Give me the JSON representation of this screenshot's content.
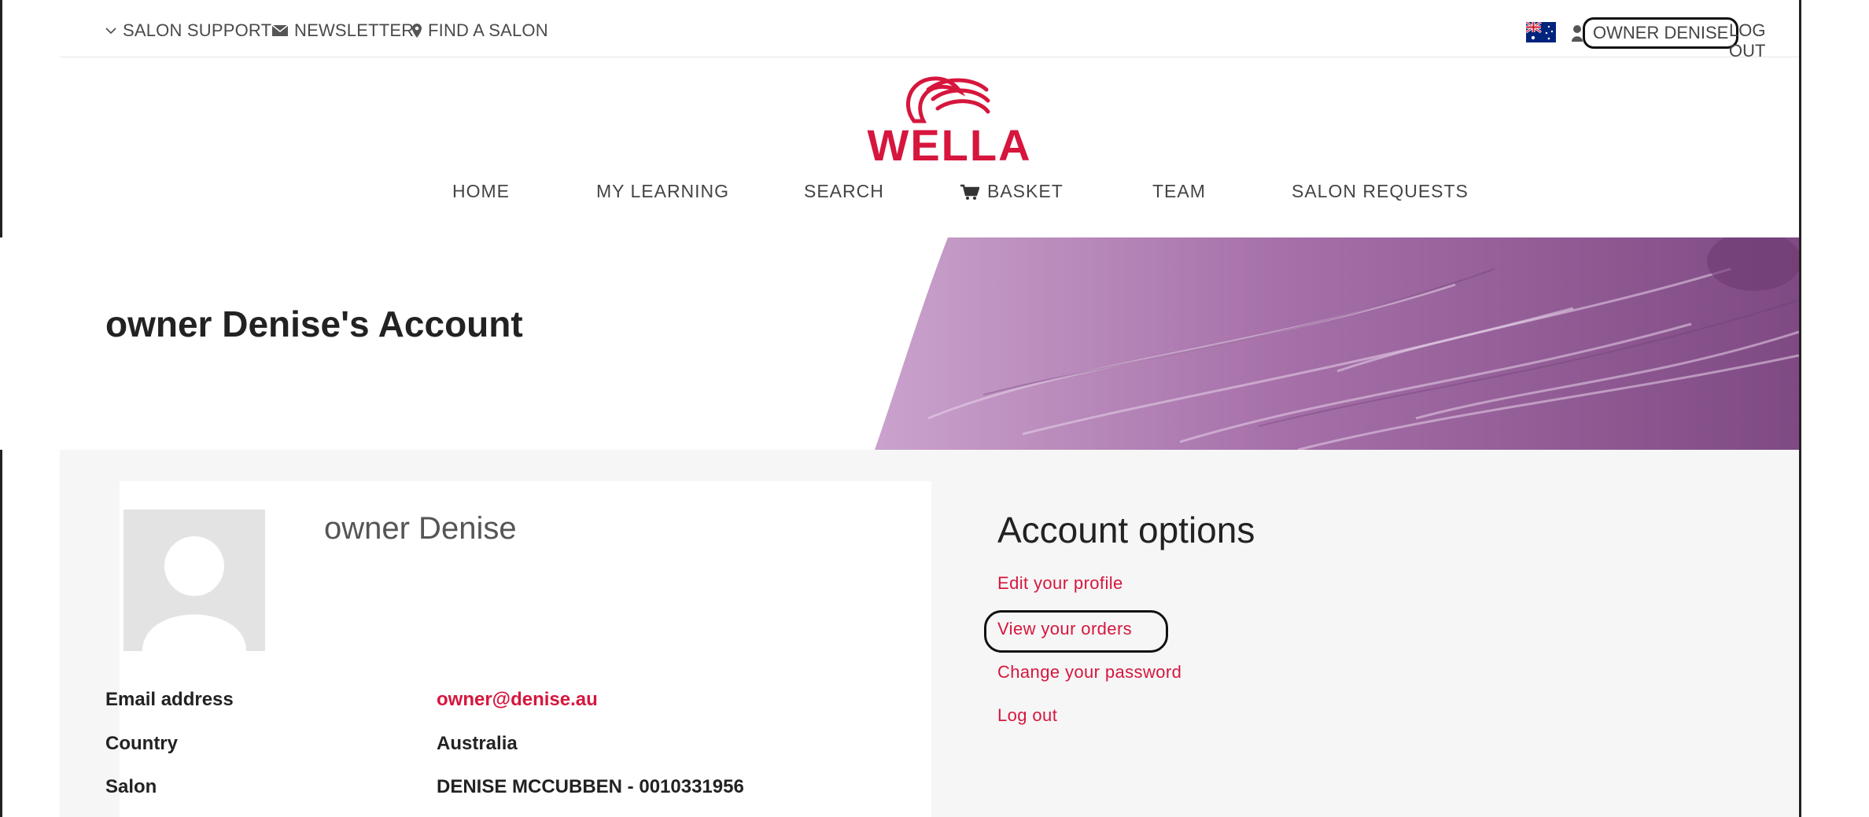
{
  "topbar": {
    "salon_support": "SALON SUPPORT",
    "newsletter": "NEWSLETTER",
    "find_salon": "FIND A SALON",
    "user_name": "OWNER DENISE",
    "logout": "LOG OUT"
  },
  "brand": {
    "logo_text": "WELLA",
    "color": "#d6163d"
  },
  "nav": {
    "home": "HOME",
    "my_learning": "MY LEARNING",
    "search": "SEARCH",
    "basket": "BASKET",
    "team": "TEAM",
    "salon_requests": "SALON REQUESTS"
  },
  "hero": {
    "title": "owner Denise's Account",
    "accent_color": "#b07bb3"
  },
  "profile": {
    "name": "owner Denise",
    "fields": [
      {
        "label": "Email address",
        "value": "owner@denise.au"
      },
      {
        "label": "Country",
        "value": "Australia"
      },
      {
        "label": "Salon",
        "value": "DENISE MCCUBBEN - 0010331956"
      }
    ]
  },
  "account_options": {
    "title": "Account options",
    "links": [
      "Edit your profile",
      "View your orders",
      "Change your password",
      "Log out"
    ]
  },
  "icons": [
    "chevron-down-icon",
    "envelope-icon",
    "map-pin-icon",
    "australia-flag-icon",
    "user-icon",
    "cart-icon",
    "avatar-placeholder-icon"
  ]
}
